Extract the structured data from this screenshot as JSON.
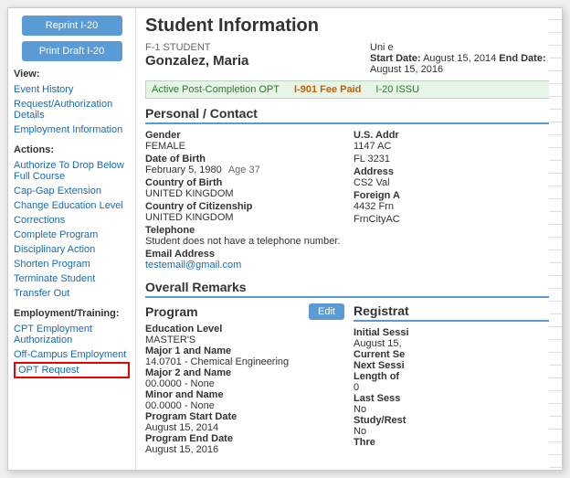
{
  "buttons": {
    "reprint": "Reprint I-20",
    "print_draft": "Print Draft I-20"
  },
  "sidebar": {
    "view_label": "View:",
    "view_links": [
      {
        "label": "Event History"
      },
      {
        "label": "Request/Authorization Details"
      },
      {
        "label": "Employment Information"
      }
    ],
    "actions_label": "Actions:",
    "action_links": [
      {
        "label": "Authorize To Drop Below Full Course"
      },
      {
        "label": "Cap-Gap Extension"
      },
      {
        "label": "Change Education Level"
      },
      {
        "label": "Corrections"
      },
      {
        "label": "Complete Program"
      },
      {
        "label": "Disciplinary Action"
      },
      {
        "label": "Shorten Program"
      },
      {
        "label": "Terminate Student"
      },
      {
        "label": "Transfer Out"
      }
    ],
    "employment_label": "Employment/Training:",
    "employment_links": [
      {
        "label": "CPT Employment Authorization"
      },
      {
        "label": "Off-Campus Employment"
      },
      {
        "label": "OPT Request",
        "highlighted": true
      }
    ]
  },
  "main": {
    "page_title": "Student Information",
    "student_type": "F-1 STUDENT",
    "university_partial": "Uni                    e",
    "student_name": "Gonzalez, Maria",
    "start_label": "Start Date:",
    "start_date": "August 15, 2014",
    "end_label": "End Date:",
    "end_date": "August 15, 2016",
    "status_opt": "Active Post-Completion OPT",
    "status_fee": "I-901 Fee Paid",
    "status_i20": "I-20 ISSU",
    "personal_contact_title": "Personal / Contact",
    "gender_label": "Gender",
    "gender_value": "FEMALE",
    "dob_label": "Date of Birth",
    "dob_value": "February 5, 1980",
    "age_text": "Age 37",
    "cob_label": "Country of Birth",
    "cob_value": "UNITED KINGDOM",
    "coc_label": "Country of Citizenship",
    "coc_value": "UNITED KINGDOM",
    "telephone_label": "Telephone",
    "telephone_note": "Student does not have a telephone number.",
    "email_label": "Email Address",
    "email_value": "testemail@gmail.com",
    "us_addr_label": "U.S. Addr",
    "us_addr_value": "1147 AC",
    "state_value": "FL 3231",
    "addr_label": "Address",
    "addr_value": "CS2 Val",
    "foreign_label": "Foreign A",
    "foreign_value": "4432 Frn",
    "frn_city_label": "FrnCityAC",
    "overall_remarks_title": "Overall Remarks",
    "program_title": "Program",
    "edit_btn": "Edit",
    "edu_level_label": "Education Level",
    "edu_level_value": "MASTER'S",
    "major1_label": "Major 1 and Name",
    "major1_value": "14.0701 - Chemical Engineering",
    "major2_label": "Major 2 and Name",
    "major2_value": "00.0000 - None",
    "minor_label": "Minor and Name",
    "minor_value": "00.0000 - None",
    "prog_start_label": "Program Start Date",
    "prog_start_value": "August 15, 2014",
    "prog_end_label": "Program End Date",
    "prog_end_value": "August 15, 2016",
    "registration_title": "Registrat",
    "initial_session_label": "Initial Sessi",
    "initial_session_value": "August 15,",
    "current_se_label": "Current Se",
    "next_sess_label": "Next Sessi",
    "length_label": "Length of",
    "length_value": "0",
    "last_sess_label": "Last Sess",
    "last_sess_value": "No",
    "study_rest_label": "Study/Rest",
    "study_rest_value": "No",
    "three_label": "Thre"
  }
}
